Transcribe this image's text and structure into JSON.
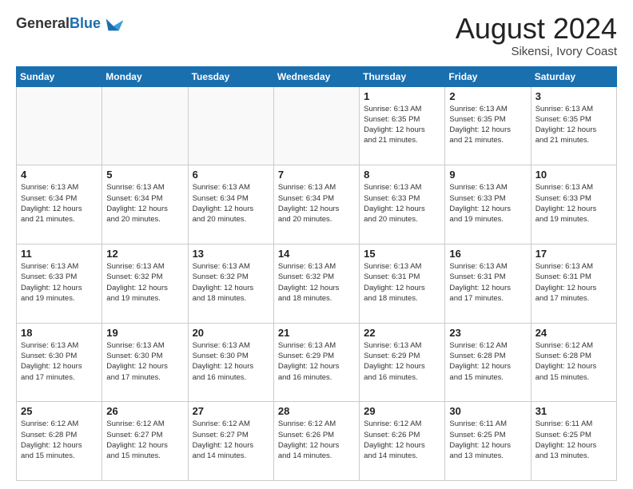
{
  "header": {
    "logo_general": "General",
    "logo_blue": "Blue",
    "main_title": "August 2024",
    "subtitle": "Sikensi, Ivory Coast"
  },
  "calendar": {
    "days_of_week": [
      "Sunday",
      "Monday",
      "Tuesday",
      "Wednesday",
      "Thursday",
      "Friday",
      "Saturday"
    ],
    "weeks": [
      {
        "days": [
          {
            "num": "",
            "info": "",
            "empty": true
          },
          {
            "num": "",
            "info": "",
            "empty": true
          },
          {
            "num": "",
            "info": "",
            "empty": true
          },
          {
            "num": "",
            "info": "",
            "empty": true
          },
          {
            "num": "1",
            "info": "Sunrise: 6:13 AM\nSunset: 6:35 PM\nDaylight: 12 hours\nand 21 minutes.",
            "empty": false
          },
          {
            "num": "2",
            "info": "Sunrise: 6:13 AM\nSunset: 6:35 PM\nDaylight: 12 hours\nand 21 minutes.",
            "empty": false
          },
          {
            "num": "3",
            "info": "Sunrise: 6:13 AM\nSunset: 6:35 PM\nDaylight: 12 hours\nand 21 minutes.",
            "empty": false
          }
        ]
      },
      {
        "days": [
          {
            "num": "4",
            "info": "Sunrise: 6:13 AM\nSunset: 6:34 PM\nDaylight: 12 hours\nand 21 minutes.",
            "empty": false
          },
          {
            "num": "5",
            "info": "Sunrise: 6:13 AM\nSunset: 6:34 PM\nDaylight: 12 hours\nand 20 minutes.",
            "empty": false
          },
          {
            "num": "6",
            "info": "Sunrise: 6:13 AM\nSunset: 6:34 PM\nDaylight: 12 hours\nand 20 minutes.",
            "empty": false
          },
          {
            "num": "7",
            "info": "Sunrise: 6:13 AM\nSunset: 6:34 PM\nDaylight: 12 hours\nand 20 minutes.",
            "empty": false
          },
          {
            "num": "8",
            "info": "Sunrise: 6:13 AM\nSunset: 6:33 PM\nDaylight: 12 hours\nand 20 minutes.",
            "empty": false
          },
          {
            "num": "9",
            "info": "Sunrise: 6:13 AM\nSunset: 6:33 PM\nDaylight: 12 hours\nand 19 minutes.",
            "empty": false
          },
          {
            "num": "10",
            "info": "Sunrise: 6:13 AM\nSunset: 6:33 PM\nDaylight: 12 hours\nand 19 minutes.",
            "empty": false
          }
        ]
      },
      {
        "days": [
          {
            "num": "11",
            "info": "Sunrise: 6:13 AM\nSunset: 6:33 PM\nDaylight: 12 hours\nand 19 minutes.",
            "empty": false
          },
          {
            "num": "12",
            "info": "Sunrise: 6:13 AM\nSunset: 6:32 PM\nDaylight: 12 hours\nand 19 minutes.",
            "empty": false
          },
          {
            "num": "13",
            "info": "Sunrise: 6:13 AM\nSunset: 6:32 PM\nDaylight: 12 hours\nand 18 minutes.",
            "empty": false
          },
          {
            "num": "14",
            "info": "Sunrise: 6:13 AM\nSunset: 6:32 PM\nDaylight: 12 hours\nand 18 minutes.",
            "empty": false
          },
          {
            "num": "15",
            "info": "Sunrise: 6:13 AM\nSunset: 6:31 PM\nDaylight: 12 hours\nand 18 minutes.",
            "empty": false
          },
          {
            "num": "16",
            "info": "Sunrise: 6:13 AM\nSunset: 6:31 PM\nDaylight: 12 hours\nand 17 minutes.",
            "empty": false
          },
          {
            "num": "17",
            "info": "Sunrise: 6:13 AM\nSunset: 6:31 PM\nDaylight: 12 hours\nand 17 minutes.",
            "empty": false
          }
        ]
      },
      {
        "days": [
          {
            "num": "18",
            "info": "Sunrise: 6:13 AM\nSunset: 6:30 PM\nDaylight: 12 hours\nand 17 minutes.",
            "empty": false
          },
          {
            "num": "19",
            "info": "Sunrise: 6:13 AM\nSunset: 6:30 PM\nDaylight: 12 hours\nand 17 minutes.",
            "empty": false
          },
          {
            "num": "20",
            "info": "Sunrise: 6:13 AM\nSunset: 6:30 PM\nDaylight: 12 hours\nand 16 minutes.",
            "empty": false
          },
          {
            "num": "21",
            "info": "Sunrise: 6:13 AM\nSunset: 6:29 PM\nDaylight: 12 hours\nand 16 minutes.",
            "empty": false
          },
          {
            "num": "22",
            "info": "Sunrise: 6:13 AM\nSunset: 6:29 PM\nDaylight: 12 hours\nand 16 minutes.",
            "empty": false
          },
          {
            "num": "23",
            "info": "Sunrise: 6:12 AM\nSunset: 6:28 PM\nDaylight: 12 hours\nand 15 minutes.",
            "empty": false
          },
          {
            "num": "24",
            "info": "Sunrise: 6:12 AM\nSunset: 6:28 PM\nDaylight: 12 hours\nand 15 minutes.",
            "empty": false
          }
        ]
      },
      {
        "days": [
          {
            "num": "25",
            "info": "Sunrise: 6:12 AM\nSunset: 6:28 PM\nDaylight: 12 hours\nand 15 minutes.",
            "empty": false
          },
          {
            "num": "26",
            "info": "Sunrise: 6:12 AM\nSunset: 6:27 PM\nDaylight: 12 hours\nand 15 minutes.",
            "empty": false
          },
          {
            "num": "27",
            "info": "Sunrise: 6:12 AM\nSunset: 6:27 PM\nDaylight: 12 hours\nand 14 minutes.",
            "empty": false
          },
          {
            "num": "28",
            "info": "Sunrise: 6:12 AM\nSunset: 6:26 PM\nDaylight: 12 hours\nand 14 minutes.",
            "empty": false
          },
          {
            "num": "29",
            "info": "Sunrise: 6:12 AM\nSunset: 6:26 PM\nDaylight: 12 hours\nand 14 minutes.",
            "empty": false
          },
          {
            "num": "30",
            "info": "Sunrise: 6:11 AM\nSunset: 6:25 PM\nDaylight: 12 hours\nand 13 minutes.",
            "empty": false
          },
          {
            "num": "31",
            "info": "Sunrise: 6:11 AM\nSunset: 6:25 PM\nDaylight: 12 hours\nand 13 minutes.",
            "empty": false
          }
        ]
      }
    ]
  }
}
